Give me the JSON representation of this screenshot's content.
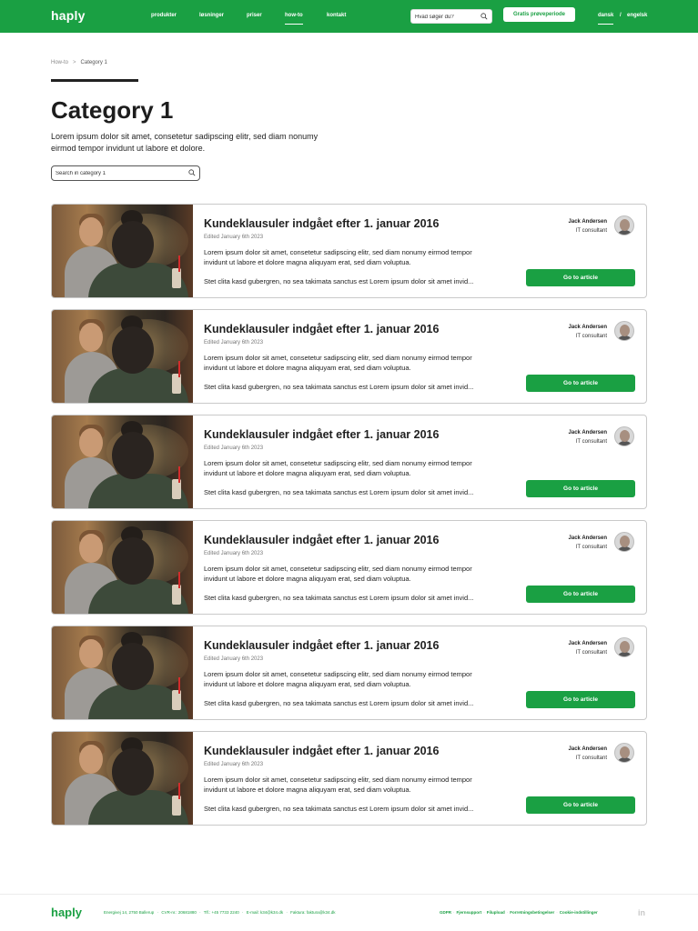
{
  "header": {
    "logo": "haply",
    "nav": [
      "produkter",
      "løsninger",
      "priser",
      "how-to",
      "kontakt"
    ],
    "search_placeholder": "Hvad søger du?",
    "trial_label": "Gratis prøveperiode",
    "lang_dansk": "dansk",
    "lang_sep": "/",
    "lang_engelsk": "engelsk"
  },
  "breadcrumb": {
    "first": "How-to",
    "sep": ">",
    "current": "Category 1"
  },
  "page": {
    "title": "Category 1",
    "intro": "Lorem ipsum dolor sit amet, consetetur sadipscing elitr, sed diam nonumy eirmod tempor invidunt ut labore et dolore.",
    "search_placeholder": "Search in category 1"
  },
  "articles": [
    {
      "title": "Kundeklausuler indgået efter 1. januar 2016",
      "edited": "Edited January 6th 2023",
      "text": "Lorem ipsum dolor sit amet, consetetur sadipscing elitr, sed diam nonumy eirmod tempor invidunt ut labore et dolore magna aliquyam erat, sed diam voluptua.",
      "text2": "Stet clita kasd gubergren, no sea takimata sanctus est Lorem ipsum dolor sit amet invid...",
      "author": "Jack Andersen",
      "role": "IT consultant",
      "button": "Go to article"
    },
    {
      "title": "Kundeklausuler indgået efter 1. januar 2016",
      "edited": "Edited January 6th 2023",
      "text": "Lorem ipsum dolor sit amet, consetetur sadipscing elitr, sed diam nonumy eirmod tempor invidunt ut labore et dolore magna aliquyam erat, sed diam voluptua.",
      "text2": "Stet clita kasd gubergren, no sea takimata sanctus est Lorem ipsum dolor sit amet invid...",
      "author": "Jack Andersen",
      "role": "IT consultant",
      "button": "Go to article"
    },
    {
      "title": "Kundeklausuler indgået efter 1. januar 2016",
      "edited": "Edited January 6th 2023",
      "text": "Lorem ipsum dolor sit amet, consetetur sadipscing elitr, sed diam nonumy eirmod tempor invidunt ut labore et dolore magna aliquyam erat, sed diam voluptua.",
      "text2": "Stet clita kasd gubergren, no sea takimata sanctus est Lorem ipsum dolor sit amet invid...",
      "author": "Jack Andersen",
      "role": "IT consultant",
      "button": "Go to article"
    },
    {
      "title": "Kundeklausuler indgået efter 1. januar 2016",
      "edited": "Edited January 6th 2023",
      "text": "Lorem ipsum dolor sit amet, consetetur sadipscing elitr, sed diam nonumy eirmod tempor invidunt ut labore et dolore magna aliquyam erat, sed diam voluptua.",
      "text2": "Stet clita kasd gubergren, no sea takimata sanctus est Lorem ipsum dolor sit amet invid...",
      "author": "Jack Andersen",
      "role": "IT consultant",
      "button": "Go to article"
    },
    {
      "title": "Kundeklausuler indgået efter 1. januar 2016",
      "edited": "Edited January 6th 2023",
      "text": "Lorem ipsum dolor sit amet, consetetur sadipscing elitr, sed diam nonumy eirmod tempor invidunt ut labore et dolore magna aliquyam erat, sed diam voluptua.",
      "text2": "Stet clita kasd gubergren, no sea takimata sanctus est Lorem ipsum dolor sit amet invid...",
      "author": "Jack Andersen",
      "role": "IT consultant",
      "button": "Go to article"
    },
    {
      "title": "Kundeklausuler indgået efter 1. januar 2016",
      "edited": "Edited January 6th 2023",
      "text": "Lorem ipsum dolor sit amet, consetetur sadipscing elitr, sed diam nonumy eirmod tempor invidunt ut labore et dolore magna aliquyam erat, sed diam voluptua.",
      "text2": "Stet clita kasd gubergren, no sea takimata sanctus est Lorem ipsum dolor sit amet invid...",
      "author": "Jack Andersen",
      "role": "IT consultant",
      "button": "Go to article"
    }
  ],
  "footer": {
    "logo": "haply",
    "info": [
      "Energivej 14, 2750 Ballerup",
      "·",
      "CVR-nr.: 20681880",
      "·",
      "Tlf.: +45 7733 2240",
      "·",
      "E-mail: k34@k34.dk",
      "·",
      "Faktura: faktura@k34.dk"
    ],
    "links": [
      "GDPR",
      "Fjernsupport",
      "Filupload",
      "Forretningsbetingelser",
      "Cookie-indstillinger"
    ],
    "linkedin": "in"
  },
  "colors": {
    "brand": "#1aa043",
    "text": "#222222"
  },
  "icons": {
    "search": "search-icon",
    "avatar": "avatar",
    "linkedin": "linkedin-icon"
  }
}
